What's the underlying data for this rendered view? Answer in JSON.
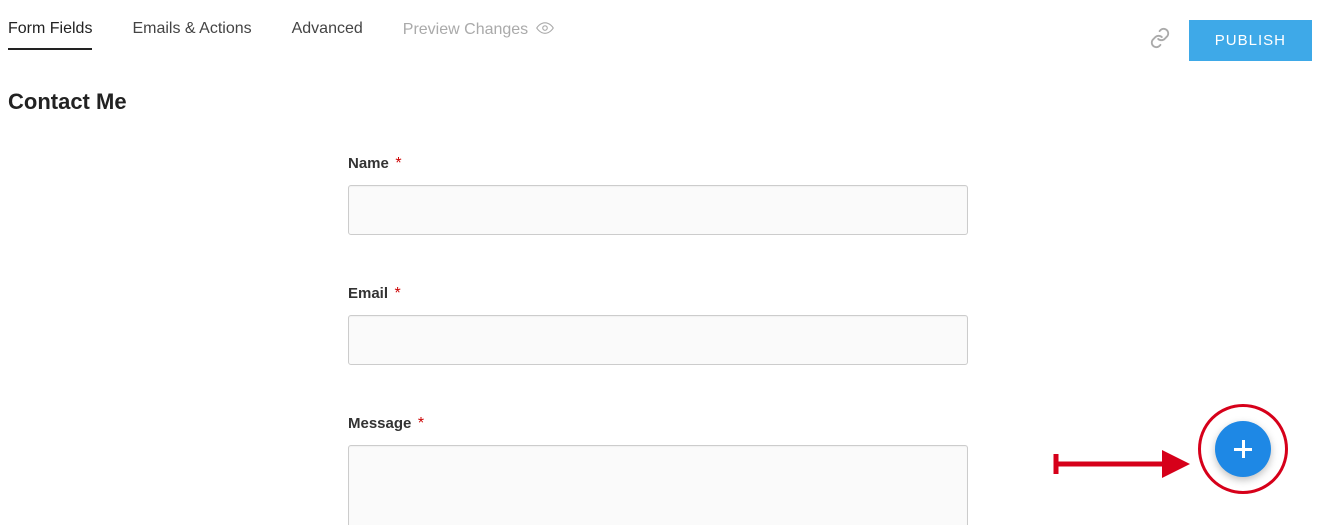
{
  "tabs": {
    "formFields": "Form Fields",
    "emailsActions": "Emails & Actions",
    "advanced": "Advanced",
    "previewChanges": "Preview Changes"
  },
  "header": {
    "publish": "PUBLISH"
  },
  "pageTitle": "Contact Me",
  "fields": {
    "name": {
      "label": "Name",
      "required": "*"
    },
    "email": {
      "label": "Email",
      "required": "*"
    },
    "message": {
      "label": "Message",
      "required": "*"
    }
  }
}
